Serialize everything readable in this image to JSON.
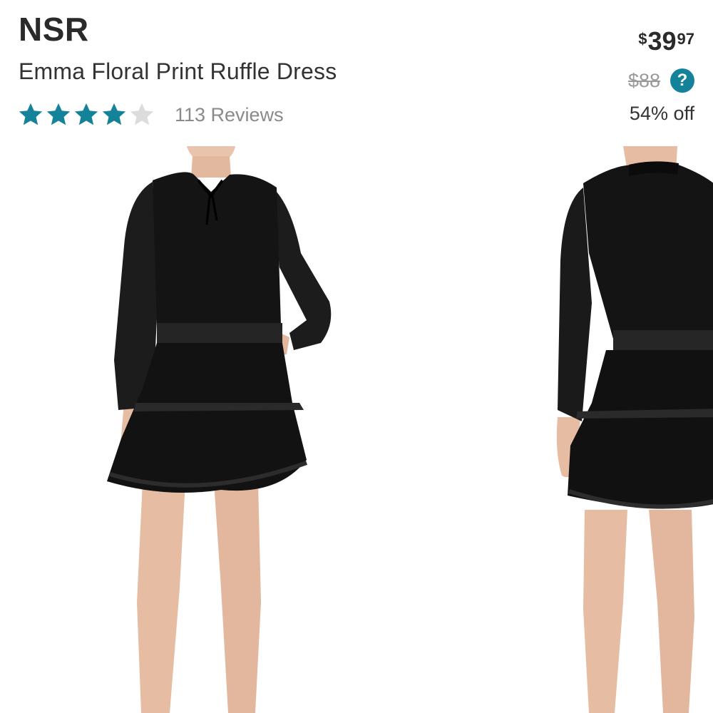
{
  "product": {
    "brand": "NSR",
    "title": "Emma Floral Print Ruffle Dress",
    "rating": {
      "value": 4,
      "max": 5,
      "reviews_label": "113 Reviews",
      "star_color": "#14839a",
      "empty_star_color": "#dcdcdc"
    },
    "price": {
      "currency": "$",
      "whole": "39",
      "cents": "97",
      "original": "$88",
      "discount": "54% off",
      "help_label": "?"
    }
  },
  "images": [
    {
      "view": "front",
      "name": "product-image-front"
    },
    {
      "view": "back",
      "name": "product-image-back"
    }
  ]
}
